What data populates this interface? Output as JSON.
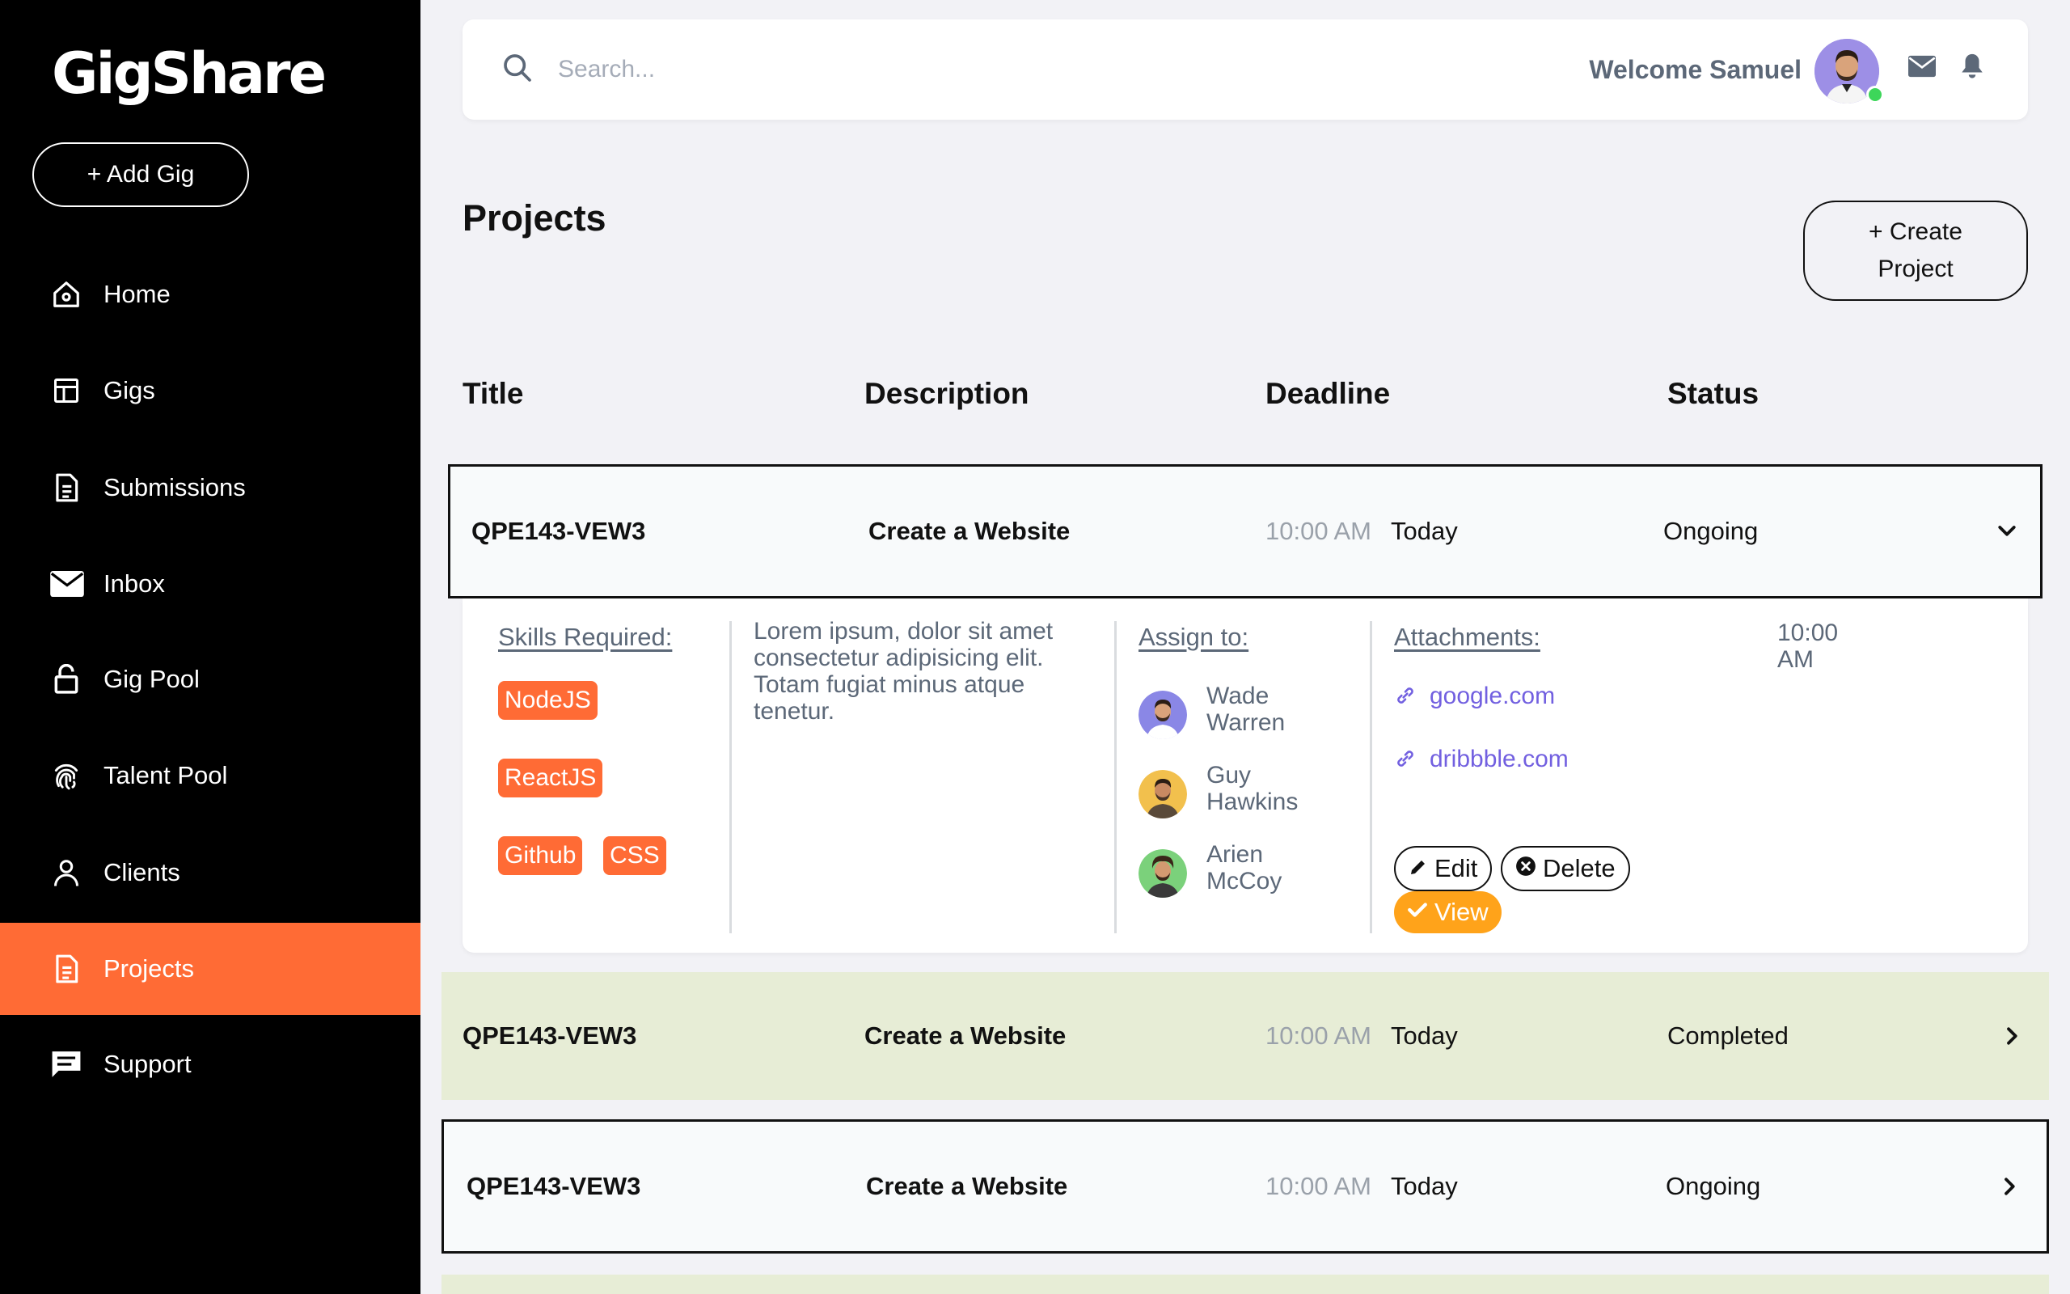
{
  "app": {
    "name": "GigShare"
  },
  "sidebar": {
    "add_gig_label": "+ Add Gig",
    "items": [
      {
        "label": "Home",
        "icon": "home-icon"
      },
      {
        "label": "Gigs",
        "icon": "layout-icon"
      },
      {
        "label": "Submissions",
        "icon": "document-icon"
      },
      {
        "label": "Inbox",
        "icon": "mail-icon"
      },
      {
        "label": "Gig Pool",
        "icon": "lock-icon"
      },
      {
        "label": "Talent Pool",
        "icon": "fingerprint-icon"
      },
      {
        "label": "Clients",
        "icon": "user-icon"
      },
      {
        "label": "Projects",
        "icon": "document-icon",
        "active": true
      },
      {
        "label": "Support",
        "icon": "chat-icon"
      }
    ]
  },
  "topbar": {
    "search_placeholder": "Search...",
    "welcome_text": "Welcome Samuel"
  },
  "page": {
    "title": "Projects",
    "create_button_line1": "+ Create",
    "create_button_line2": "Project"
  },
  "table": {
    "headers": [
      "Title",
      "Description",
      "Deadline",
      "Status"
    ],
    "rows": [
      {
        "title": "QPE143-VEW3",
        "description": "Create a Website",
        "time": "10:00 AM",
        "day": "Today",
        "status": "Ongoing",
        "expanded": true
      },
      {
        "title": "QPE143-VEW3",
        "description": "Create a Website",
        "time": "10:00 AM",
        "day": "Today",
        "status": "Completed",
        "expanded": false
      },
      {
        "title": "QPE143-VEW3",
        "description": "Create a Website",
        "time": "10:00 AM",
        "day": "Today",
        "status": "Ongoing",
        "expanded": false
      }
    ]
  },
  "details": {
    "skills_label": "Skills Required:",
    "skills": [
      "NodeJS",
      "ReactJS",
      "Github",
      "CSS"
    ],
    "description": "Lorem ipsum, dolor sit amet consectetur adipisicing elit. Totam fugiat minus atque tenetur.",
    "assign_label": "Assign to:",
    "assignees": [
      {
        "name_line1": "Wade",
        "name_line2": "Warren"
      },
      {
        "name_line1": "Guy",
        "name_line2": "Hawkins"
      },
      {
        "name_line1": "Arien",
        "name_line2": "McCoy"
      }
    ],
    "attachments_label": "Attachments:",
    "attachments": [
      "google.com",
      "dribbble.com"
    ],
    "time_line1": "10:00",
    "time_line2": "AM",
    "edit_label": "Edit",
    "delete_label": "Delete",
    "view_label": "View"
  },
  "colors": {
    "accent": "#ff6b35",
    "sidebar_bg": "#000000",
    "completed_row": "#e7edd6",
    "link": "#7260e0",
    "view_button": "#ffa31a",
    "online": "#3dd65a"
  }
}
